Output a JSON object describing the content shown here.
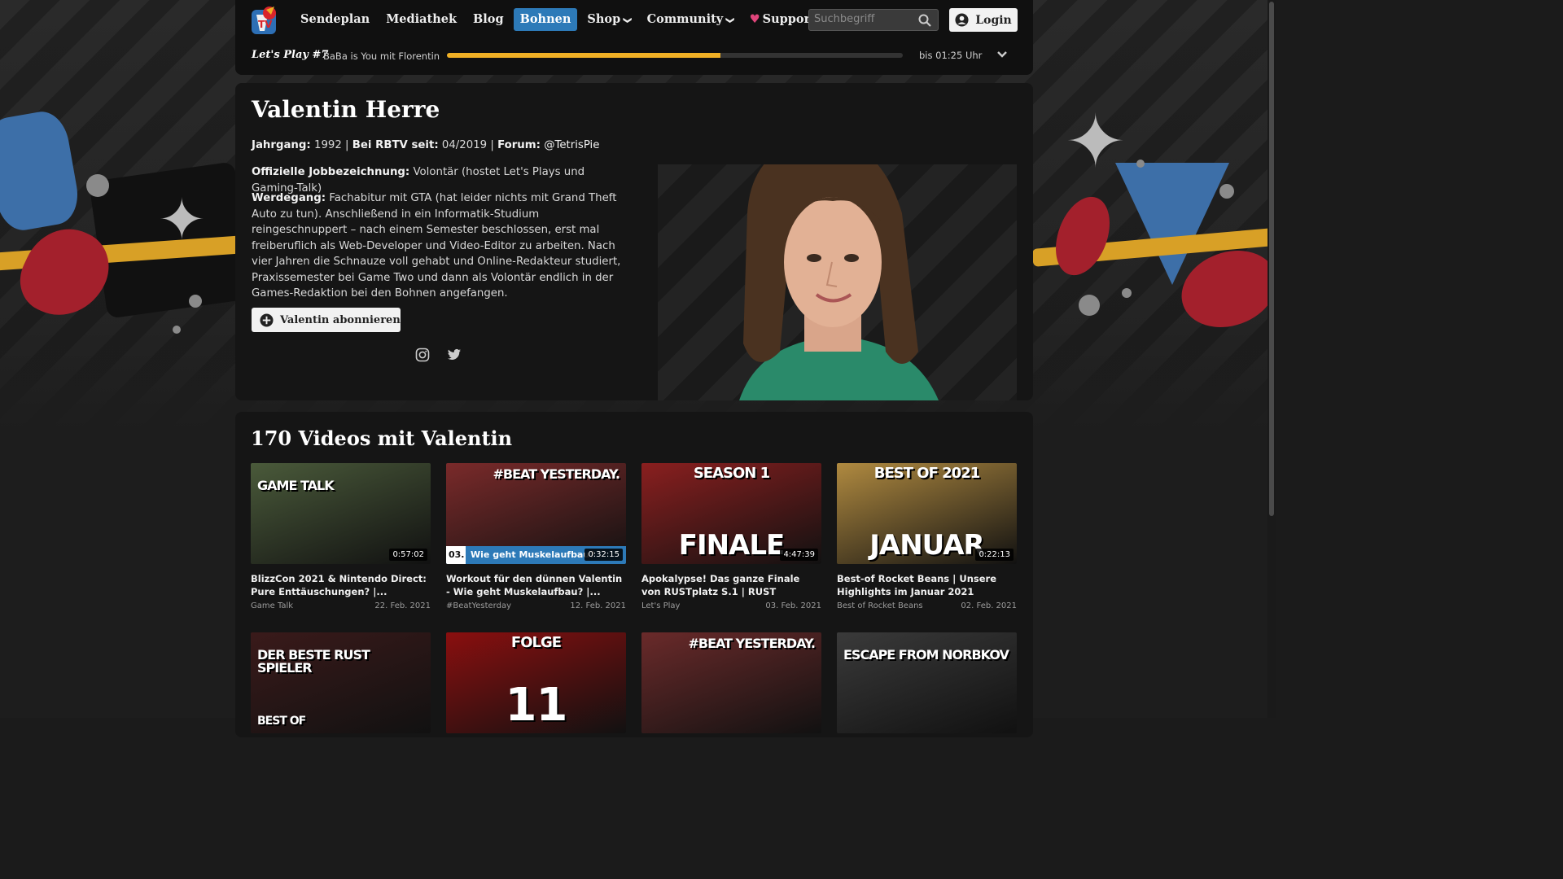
{
  "nav": {
    "logo_alt": "RBTV",
    "items": [
      {
        "label": "Sendeplan",
        "active": false,
        "dropdown": false
      },
      {
        "label": "Mediathek",
        "active": false,
        "dropdown": false
      },
      {
        "label": "Blog",
        "active": false,
        "dropdown": false
      },
      {
        "label": "Bohnen",
        "active": true,
        "dropdown": false
      },
      {
        "label": "Shop",
        "active": false,
        "dropdown": true
      },
      {
        "label": "Community",
        "active": false,
        "dropdown": true
      },
      {
        "label": "Supporte uns",
        "active": false,
        "dropdown": true,
        "icon": "heart-icon"
      }
    ],
    "search_placeholder": "Suchbegriff",
    "login_label": "Login",
    "accent_color": "#2d7ab8"
  },
  "live": {
    "show": "Let's Play #7",
    "title": "BaBa is You mit Florentin",
    "progress_percent": 60,
    "end_time": "bis 01:25 Uhr",
    "progress_color": "#f0b025"
  },
  "profile": {
    "name": "Valentin Herre",
    "jahrgang_label": "Jahrgang:",
    "jahrgang": "1992",
    "seit_label": "Bei RBTV seit:",
    "seit": "04/2019",
    "forum_label": "Forum:",
    "forum": "@TetrisPie",
    "job_label": "Offizielle Jobbezeichnung:",
    "job": "Volontär (hostet Let's Plays und Gaming-Talk)",
    "werdegang_label": "Werdegang:",
    "werdegang": "Fachabitur mit GTA (hat leider nichts mit Grand Theft Auto zu tun). Anschließend in ein Informatik-Studium reingeschnuppert – nach einem Semester beschlossen, erst mal freiberuflich als Web-Developer und Video-Editor zu arbeiten. Nach vier Jahren die Schnauze voll gehabt und Online-Redakteur studiert, Praxissemester bei Game Two und dann als Volontär endlich in der Games-Redaktion bei den Bohnen angefangen.",
    "subscribe_label": "Valentin abonnieren",
    "socials": [
      "instagram-icon",
      "twitter-icon"
    ]
  },
  "videos": {
    "heading": "170 Videos mit Valentin",
    "items": [
      {
        "title": "BlizzCon 2021 & Nintendo Direct: Pure Enttäuschungen? |...",
        "show": "Game Talk",
        "date": "22. Feb. 2021",
        "duration": "0:57:02",
        "thumb_text": "GAME TALK",
        "thumb_bg": "#4a5a3a"
      },
      {
        "title": "Workout für den dünnen Valentin - Wie geht Muskelaufbau? |...",
        "show": "#BeatYesterday",
        "date": "12. Feb. 2021",
        "duration": "0:32:15",
        "thumb_text": "#BEAT YESTERDAY.",
        "thumb_sub": "Wie geht Muskelaufbau?",
        "thumb_num": "03.",
        "thumb_bg": "#7a2a2a"
      },
      {
        "title": "Apokalypse! Das ganze Finale von RUSTplatz S.1 | RUST",
        "show": "Let's Play",
        "date": "03. Feb. 2021",
        "duration": "4:47:39",
        "thumb_text": "FINALE",
        "thumb_top": "SEASON 1",
        "thumb_bg": "#8a1f1f"
      },
      {
        "title": "Best-of Rocket Beans | Unsere Highlights im Januar 2021",
        "show": "Best of Rocket Beans",
        "date": "02. Feb. 2021",
        "duration": "0:22:13",
        "thumb_text": "JANUAR",
        "thumb_top": "BEST OF 2021",
        "thumb_bg": "#b08a40"
      },
      {
        "title": "",
        "show": "",
        "date": "",
        "duration": "",
        "thumb_text": "DER BESTE RUST SPIELER",
        "thumb_sub": "BEST OF",
        "thumb_bg": "#3a1a1a"
      },
      {
        "title": "",
        "show": "",
        "date": "",
        "duration": "",
        "thumb_text": "11",
        "thumb_top": "FOLGE",
        "thumb_bg": "#8a0f0f"
      },
      {
        "title": "",
        "show": "",
        "date": "",
        "duration": "",
        "thumb_text": "#BEAT YESTERDAY.",
        "thumb_bg": "#6a2a2a"
      },
      {
        "title": "",
        "show": "",
        "date": "",
        "duration": "",
        "thumb_text": "ESCAPE FROM NORBKOV",
        "thumb_bg": "#3a3a3a"
      }
    ]
  }
}
